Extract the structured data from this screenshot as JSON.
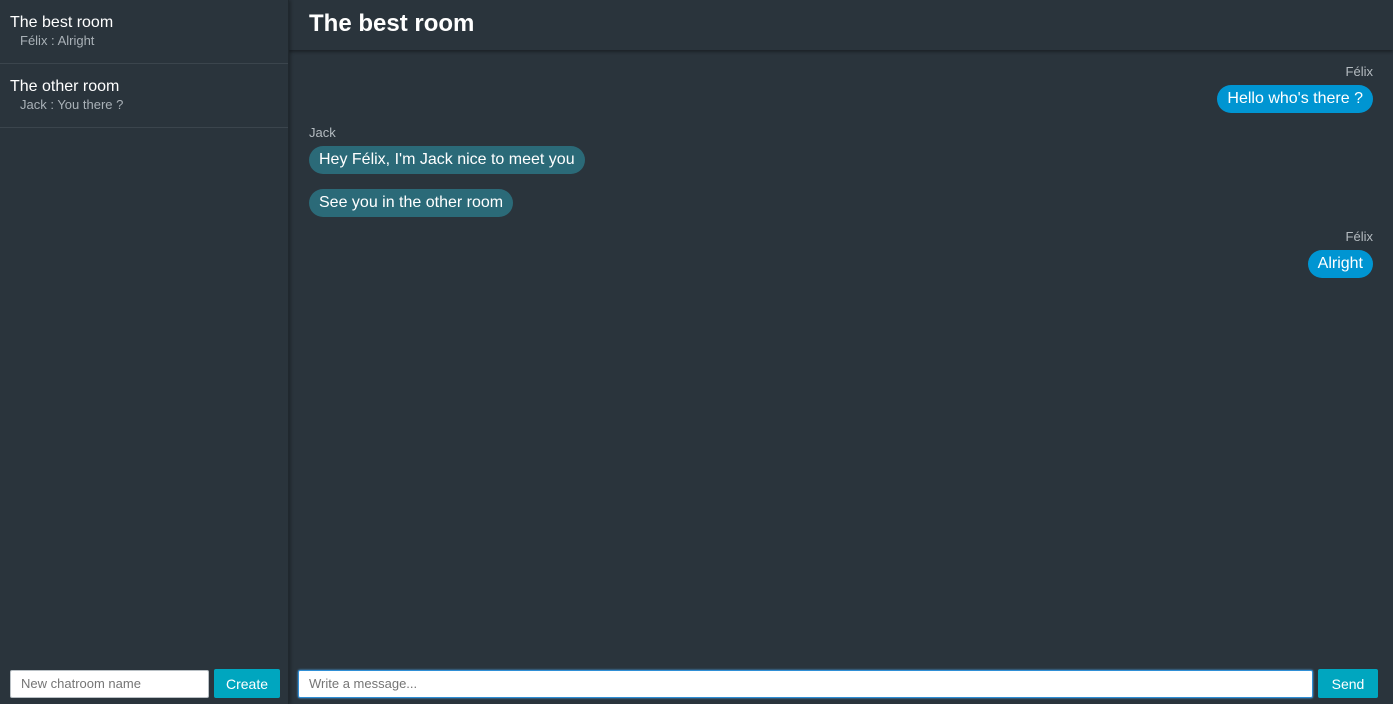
{
  "sidebar": {
    "rooms": [
      {
        "name": "The best room",
        "last_message": "Félix : Alright"
      },
      {
        "name": "The other room",
        "last_message": "Jack : You there ?"
      }
    ],
    "new_room_placeholder": "New chatroom name",
    "create_label": "Create"
  },
  "main": {
    "title": "The best room",
    "messages": [
      {
        "author": "Félix",
        "side": "right",
        "texts": [
          "Hello who's there ?"
        ]
      },
      {
        "author": "Jack",
        "side": "left",
        "texts": [
          "Hey Félix, I'm Jack nice to meet you",
          "See you in the other room"
        ]
      },
      {
        "author": "Félix",
        "side": "right",
        "texts": [
          "Alright"
        ]
      }
    ],
    "composer": {
      "placeholder": "Write a message...",
      "send_label": "Send"
    }
  },
  "colors": {
    "background": "#2a343c",
    "accent": "#00a6bf",
    "own_bubble": "#0095d2",
    "other_bubble": "#2b6a78"
  }
}
